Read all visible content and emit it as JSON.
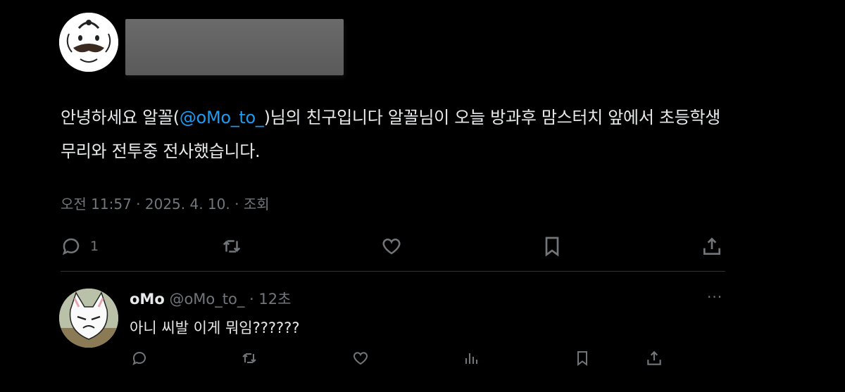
{
  "tweet": {
    "text_before": "안녕하세요 알꼴(",
    "mention": "@oMo_to_",
    "text_after": ")님의 친구입니다  알꼴님이 오늘 방과후 맘스터치 앞에서 초등학생 무리와 전투중 전사했습니다.",
    "time": "오전 11:57",
    "date": "2025. 4. 10.",
    "views_label": "조회",
    "reply_count": "1"
  },
  "reply": {
    "name": "oMo",
    "handle": "@oMo_to_",
    "time": "12초",
    "text": "아니 씨발 이게 뭐임??????",
    "more": "···"
  },
  "icons": [
    "reply-icon",
    "retweet-icon",
    "like-icon",
    "bookmark-icon",
    "share-icon",
    "views-icon",
    "more-icon"
  ],
  "colors": {
    "background": "#000000",
    "text": "#e7e9ea",
    "muted": "#71767b",
    "link": "#1d9bf0"
  }
}
